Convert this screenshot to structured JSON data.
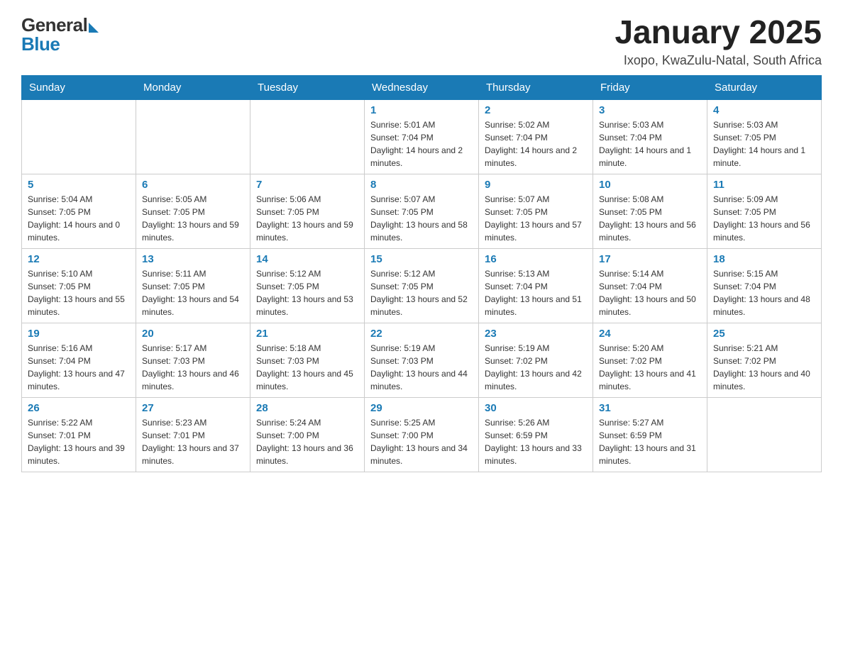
{
  "header": {
    "logo": {
      "general": "General",
      "blue": "Blue",
      "arrow": "▶"
    },
    "title": "January 2025",
    "subtitle": "Ixopo, KwaZulu-Natal, South Africa"
  },
  "calendar": {
    "days_of_week": [
      "Sunday",
      "Monday",
      "Tuesday",
      "Wednesday",
      "Thursday",
      "Friday",
      "Saturday"
    ],
    "weeks": [
      [
        {
          "day": "",
          "info": ""
        },
        {
          "day": "",
          "info": ""
        },
        {
          "day": "",
          "info": ""
        },
        {
          "day": "1",
          "info": "Sunrise: 5:01 AM\nSunset: 7:04 PM\nDaylight: 14 hours and 2 minutes."
        },
        {
          "day": "2",
          "info": "Sunrise: 5:02 AM\nSunset: 7:04 PM\nDaylight: 14 hours and 2 minutes."
        },
        {
          "day": "3",
          "info": "Sunrise: 5:03 AM\nSunset: 7:04 PM\nDaylight: 14 hours and 1 minute."
        },
        {
          "day": "4",
          "info": "Sunrise: 5:03 AM\nSunset: 7:05 PM\nDaylight: 14 hours and 1 minute."
        }
      ],
      [
        {
          "day": "5",
          "info": "Sunrise: 5:04 AM\nSunset: 7:05 PM\nDaylight: 14 hours and 0 minutes."
        },
        {
          "day": "6",
          "info": "Sunrise: 5:05 AM\nSunset: 7:05 PM\nDaylight: 13 hours and 59 minutes."
        },
        {
          "day": "7",
          "info": "Sunrise: 5:06 AM\nSunset: 7:05 PM\nDaylight: 13 hours and 59 minutes."
        },
        {
          "day": "8",
          "info": "Sunrise: 5:07 AM\nSunset: 7:05 PM\nDaylight: 13 hours and 58 minutes."
        },
        {
          "day": "9",
          "info": "Sunrise: 5:07 AM\nSunset: 7:05 PM\nDaylight: 13 hours and 57 minutes."
        },
        {
          "day": "10",
          "info": "Sunrise: 5:08 AM\nSunset: 7:05 PM\nDaylight: 13 hours and 56 minutes."
        },
        {
          "day": "11",
          "info": "Sunrise: 5:09 AM\nSunset: 7:05 PM\nDaylight: 13 hours and 56 minutes."
        }
      ],
      [
        {
          "day": "12",
          "info": "Sunrise: 5:10 AM\nSunset: 7:05 PM\nDaylight: 13 hours and 55 minutes."
        },
        {
          "day": "13",
          "info": "Sunrise: 5:11 AM\nSunset: 7:05 PM\nDaylight: 13 hours and 54 minutes."
        },
        {
          "day": "14",
          "info": "Sunrise: 5:12 AM\nSunset: 7:05 PM\nDaylight: 13 hours and 53 minutes."
        },
        {
          "day": "15",
          "info": "Sunrise: 5:12 AM\nSunset: 7:05 PM\nDaylight: 13 hours and 52 minutes."
        },
        {
          "day": "16",
          "info": "Sunrise: 5:13 AM\nSunset: 7:04 PM\nDaylight: 13 hours and 51 minutes."
        },
        {
          "day": "17",
          "info": "Sunrise: 5:14 AM\nSunset: 7:04 PM\nDaylight: 13 hours and 50 minutes."
        },
        {
          "day": "18",
          "info": "Sunrise: 5:15 AM\nSunset: 7:04 PM\nDaylight: 13 hours and 48 minutes."
        }
      ],
      [
        {
          "day": "19",
          "info": "Sunrise: 5:16 AM\nSunset: 7:04 PM\nDaylight: 13 hours and 47 minutes."
        },
        {
          "day": "20",
          "info": "Sunrise: 5:17 AM\nSunset: 7:03 PM\nDaylight: 13 hours and 46 minutes."
        },
        {
          "day": "21",
          "info": "Sunrise: 5:18 AM\nSunset: 7:03 PM\nDaylight: 13 hours and 45 minutes."
        },
        {
          "day": "22",
          "info": "Sunrise: 5:19 AM\nSunset: 7:03 PM\nDaylight: 13 hours and 44 minutes."
        },
        {
          "day": "23",
          "info": "Sunrise: 5:19 AM\nSunset: 7:02 PM\nDaylight: 13 hours and 42 minutes."
        },
        {
          "day": "24",
          "info": "Sunrise: 5:20 AM\nSunset: 7:02 PM\nDaylight: 13 hours and 41 minutes."
        },
        {
          "day": "25",
          "info": "Sunrise: 5:21 AM\nSunset: 7:02 PM\nDaylight: 13 hours and 40 minutes."
        }
      ],
      [
        {
          "day": "26",
          "info": "Sunrise: 5:22 AM\nSunset: 7:01 PM\nDaylight: 13 hours and 39 minutes."
        },
        {
          "day": "27",
          "info": "Sunrise: 5:23 AM\nSunset: 7:01 PM\nDaylight: 13 hours and 37 minutes."
        },
        {
          "day": "28",
          "info": "Sunrise: 5:24 AM\nSunset: 7:00 PM\nDaylight: 13 hours and 36 minutes."
        },
        {
          "day": "29",
          "info": "Sunrise: 5:25 AM\nSunset: 7:00 PM\nDaylight: 13 hours and 34 minutes."
        },
        {
          "day": "30",
          "info": "Sunrise: 5:26 AM\nSunset: 6:59 PM\nDaylight: 13 hours and 33 minutes."
        },
        {
          "day": "31",
          "info": "Sunrise: 5:27 AM\nSunset: 6:59 PM\nDaylight: 13 hours and 31 minutes."
        },
        {
          "day": "",
          "info": ""
        }
      ]
    ]
  }
}
